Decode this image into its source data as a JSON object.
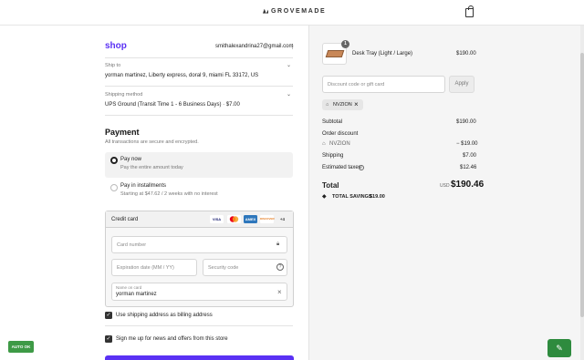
{
  "header": {
    "brand": "GROVEMADE",
    "bag_icon": "shopping-bag-icon"
  },
  "left": {
    "shop_logo": "shop",
    "email": "smithalexandrina27@gmail.com",
    "menu_icon": "⋮",
    "ship_to": {
      "label": "Ship to",
      "value": "yorman martinez, Liberty express, doral 9, miami FL 33172, US"
    },
    "shipping_method": {
      "label": "Shipping method",
      "value": "UPS Ground (Transit Time 1 - 6 Business Days) · $7.00"
    },
    "payment": {
      "title": "Payment",
      "subtitle": "All transactions are secure and encrypted.",
      "options": [
        {
          "title": "Pay now",
          "sub": "Pay the entire amount today",
          "selected": true
        },
        {
          "title": "Pay in installments",
          "sub": "Starting at $47.62 / 2 weeks with no interest",
          "selected": false
        }
      ],
      "credit_card": {
        "label": "Credit card",
        "brands": [
          "VISA",
          "MC",
          "AMEX",
          "DISCOVER"
        ],
        "more": "+4",
        "card_number_placeholder": "Card number",
        "expiry_placeholder": "Expiration date (MM / YY)",
        "security_placeholder": "Security code",
        "name_label": "Name on card",
        "name_value": "yorman martinez"
      }
    },
    "billing_checkbox": "Use shipping address as billing address",
    "news_checkbox": "Sign me up for news and offers from this store",
    "auto_ok": "AUTO OK"
  },
  "right": {
    "item": {
      "name": "Desk Tray (Light / Large)",
      "price": "$190.00",
      "qty": "1"
    },
    "discount_placeholder": "Discount code or gift card",
    "apply_label": "Apply",
    "applied_code": "NVZION",
    "subtotal_label": "Subtotal",
    "subtotal_value": "$190.00",
    "order_discount_label": "Order discount",
    "discount_code": "NVZION",
    "discount_value": "− $19.00",
    "shipping_label": "Shipping",
    "shipping_value": "$7.00",
    "taxes_label": "Estimated taxes",
    "taxes_value": "$12.46",
    "total_label": "Total",
    "currency": "USD",
    "total_value": "$190.46",
    "savings_label": "TOTAL SAVINGS",
    "savings_value": "$19.00"
  },
  "colors": {
    "accent": "#5a31f4",
    "green": "#2e8b3e"
  }
}
